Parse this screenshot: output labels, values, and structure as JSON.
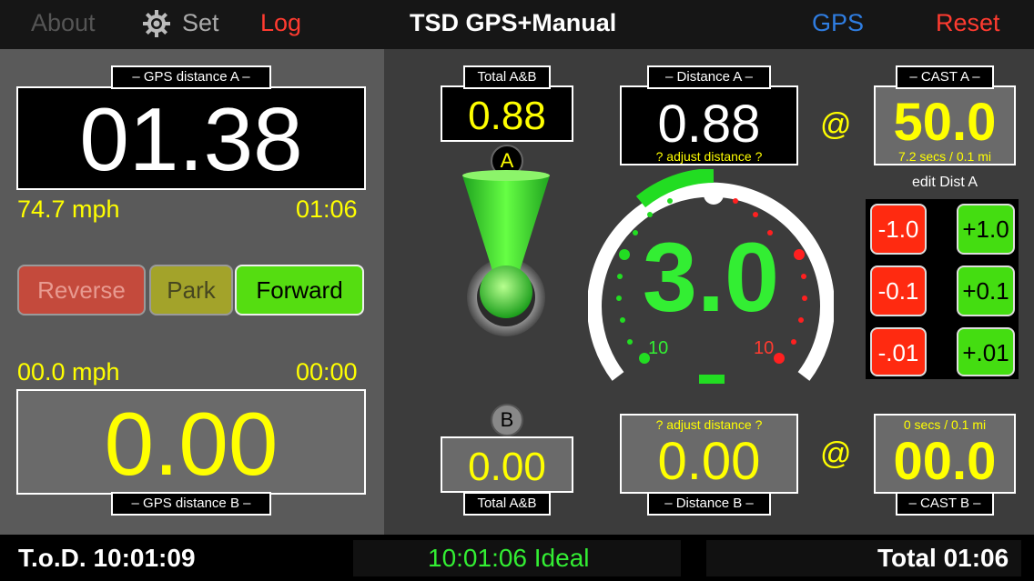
{
  "topbar": {
    "about": "About",
    "set": "Set",
    "log": "Log",
    "title": "TSD GPS+Manual",
    "gps": "GPS",
    "reset": "Reset"
  },
  "left": {
    "gps_a_label": "– GPS distance A –",
    "gps_a_value": "01.38",
    "speed_a": "74.7 mph",
    "time_a": "01:06",
    "reverse": "Reverse",
    "park": "Park",
    "forward": "Forward",
    "speed_b": "00.0 mph",
    "time_b": "00:00",
    "gps_b_value": "0.00",
    "gps_b_label": "– GPS distance B –"
  },
  "center": {
    "total_a_label": "Total A&B",
    "total_a_value": "0.88",
    "marker_a": "A",
    "marker_b": "B",
    "total_b_value": "0.00",
    "total_b_label": "Total A&B"
  },
  "distance": {
    "a_label": "– Distance A –",
    "a_value": "0.88",
    "a_adjust": "? adjust distance ?",
    "b_adjust": "? adjust distance ?",
    "b_value": "0.00",
    "b_label": "– Distance B –"
  },
  "gauge": {
    "value": "3.0",
    "left_label": "10",
    "right_label": "10",
    "minus": "–"
  },
  "cast": {
    "at_a": "@",
    "a_label": "– CAST A –",
    "a_value": "50.0",
    "a_sub": "7.2 secs / 0.1 mi",
    "edit_label": "edit Dist A",
    "buttons": [
      {
        "label": "-1.0",
        "kind": "red"
      },
      {
        "label": "+1.0",
        "kind": "grn"
      },
      {
        "label": "-0.1",
        "kind": "red"
      },
      {
        "label": "+0.1",
        "kind": "grn"
      },
      {
        "label": "-.01",
        "kind": "red"
      },
      {
        "label": "+.01",
        "kind": "grn"
      }
    ],
    "at_b": "@",
    "b_sub": "0 secs / 0.1 mi",
    "b_value": "00.0",
    "b_label": "– CAST B –"
  },
  "bottombar": {
    "tod": "T.o.D. 10:01:09",
    "ideal": "10:01:06 Ideal",
    "total": "Total 01:06"
  },
  "colors": {
    "accent_blue": "#2f7de1",
    "red": "#ff3b30",
    "yellow": "#ffff00",
    "green": "#33ee33"
  }
}
